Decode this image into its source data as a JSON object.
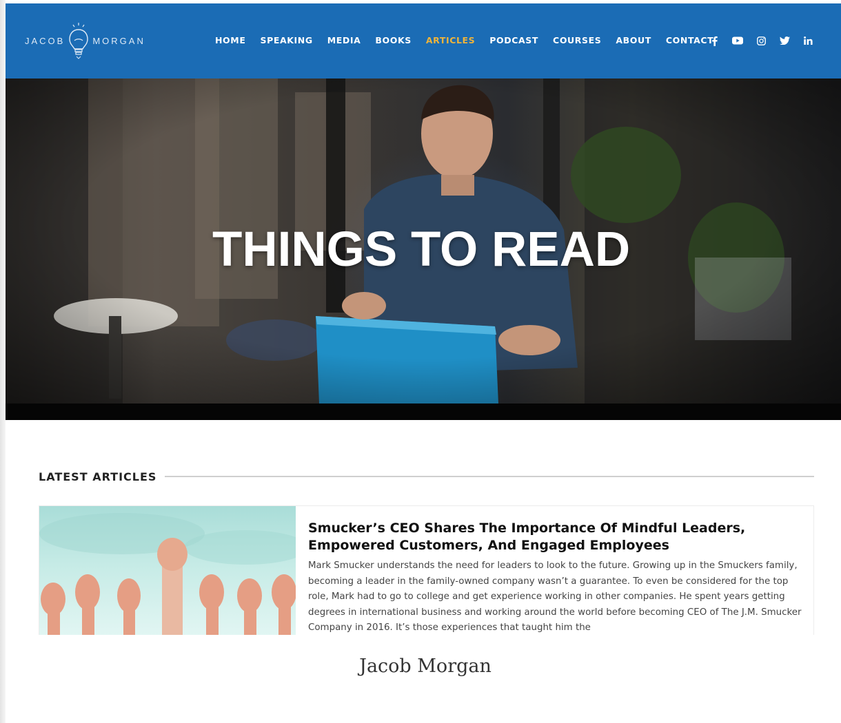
{
  "logo": {
    "left_text": "JACOB",
    "right_text": "MORGAN"
  },
  "nav": {
    "items": [
      {
        "label": "HOME",
        "active": false
      },
      {
        "label": "SPEAKING",
        "active": false
      },
      {
        "label": "MEDIA",
        "active": false
      },
      {
        "label": "BOOKS",
        "active": false
      },
      {
        "label": "ARTICLES",
        "active": true
      },
      {
        "label": "PODCAST",
        "active": false
      },
      {
        "label": "COURSES",
        "active": false
      },
      {
        "label": "ABOUT",
        "active": false
      },
      {
        "label": "CONTACT",
        "active": false
      }
    ],
    "social": [
      "facebook-icon",
      "youtube-icon",
      "instagram-icon",
      "twitter-icon",
      "linkedin-icon"
    ],
    "colors": {
      "bar": "#1b6cb5",
      "active": "#f0b43a",
      "text": "#ffffff"
    }
  },
  "hero": {
    "title": "THINGS TO READ"
  },
  "latest": {
    "heading": "LATEST ARTICLES",
    "article": {
      "title": "Smucker’s CEO Shares The Importance Of Mindful Leaders, Empowered Customers, And Engaged Employees",
      "excerpt": "Mark Smucker understands the need for leaders to look to the future. Growing up in the Smuckers family, becoming a leader in the family-owned company wasn’t a guarantee. To even be considered for the top role, Mark had to go to college and get experience working in other companies. He spent years getting degrees in international business and working around the world before becoming CEO of The J.M. Smucker Company in 2016. It’s those experiences that taught him the"
    }
  },
  "caption": "Jacob Morgan"
}
